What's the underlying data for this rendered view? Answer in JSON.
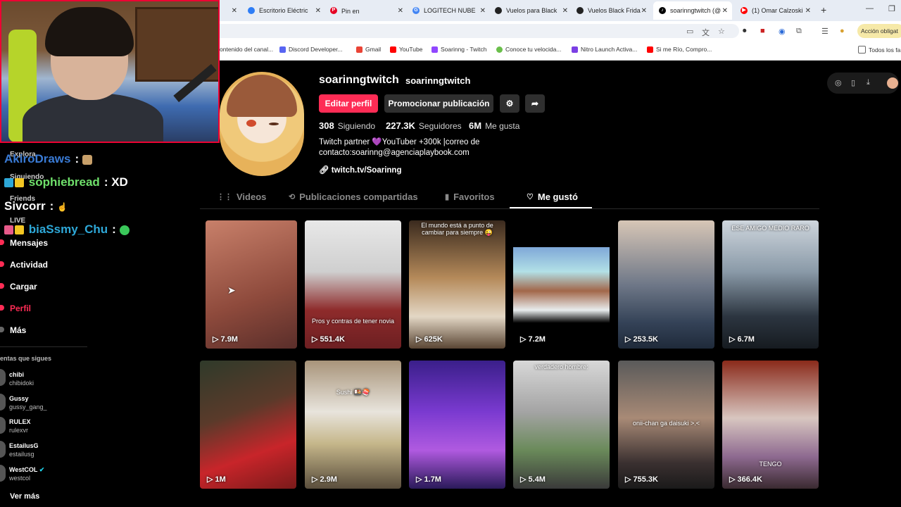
{
  "browser": {
    "tabs": [
      {
        "label": "Escritorio Eléctric",
        "color": "#2e7df6"
      },
      {
        "label": "Pin en ㅤ",
        "color": "#e60023"
      },
      {
        "label": "LOGITECH NUBE",
        "color": "#4285f4"
      },
      {
        "label": "Vuelos para Black",
        "color": "#222222"
      },
      {
        "label": "Vuelos Black Frida",
        "color": "#222222"
      },
      {
        "label": "soarinngtwitch (@",
        "color": "#000000"
      },
      {
        "label": "(1) Omar Calzoski",
        "color": "#ff0000"
      }
    ],
    "profile_chip": "Acción obligat",
    "bookmarks": [
      {
        "label": "ontenido del canal...",
        "color": "#9147ff"
      },
      {
        "label": "Discord Developer...",
        "color": "#5865f2"
      },
      {
        "label": "Gmail",
        "color": "#ea4335"
      },
      {
        "label": "YouTube",
        "color": "#ff0000"
      },
      {
        "label": "Soarinng - Twitch",
        "color": "#9147ff"
      },
      {
        "label": "Conoce tu velocida...",
        "color": "#6abf4b"
      },
      {
        "label": "Nitro Launch Activa...",
        "color": "#7b3fe4"
      },
      {
        "label": "Si me Río, Compro...",
        "color": "#ff0000"
      },
      {
        "label": "Todos los fa",
        "color": "#777777"
      }
    ]
  },
  "chat": [
    {
      "user": "AkiroDraws",
      "msg": ":",
      "color": "#3a7bd5"
    },
    {
      "user": "sophiebread",
      "msg": ": XD",
      "color": "#6fe06b"
    },
    {
      "user": "Sivcorr",
      "msg": ":",
      "color": "#ffffff"
    },
    {
      "user": "biaSsmy_Chu",
      "msg": ":",
      "color": "#2ea8d8"
    }
  ],
  "nav": {
    "items_faded": [
      "Explora",
      "Siguiendo",
      "Friends",
      "LIVE"
    ],
    "items": [
      "Mensajes",
      "Actividad",
      "Cargar",
      "Perfil",
      "Más"
    ],
    "active_color": "#fe2c55",
    "following_header": "entas que sigues",
    "following": [
      {
        "name": "chibi",
        "handle": "chibidoki"
      },
      {
        "name": "Gussy",
        "handle": "gussy_gang_"
      },
      {
        "name": "RULEX",
        "handle": "rulexvr"
      },
      {
        "name": "EstailusG",
        "handle": "estailusg"
      },
      {
        "name": "WestCOL",
        "handle": "westcol"
      }
    ],
    "see_more": "Ver más"
  },
  "profile": {
    "username": "soarinngtwitch",
    "nickname": "soarinngtwitch",
    "edit_label": "Editar perfil",
    "promote_label": "Promocionar publicación",
    "stats": [
      {
        "value": "308",
        "label": "Siguiendo"
      },
      {
        "value": "227.3K",
        "label": "Seguidores"
      },
      {
        "value": "6M",
        "label": "Me gusta"
      }
    ],
    "bio_line1": "Twitch partner 💜YouTuber +300k |correo de",
    "bio_line2": "contacto:soarinng@agenciaplaybook.com",
    "link": "twitch.tv/Soarinng",
    "accent": "#fe2c55"
  },
  "tabs": [
    "Videos",
    "Publicaciones compartidas",
    "Favoritos",
    "Me gustó"
  ],
  "videos": [
    {
      "views": "7.9M",
      "caption": "",
      "bg": "linear-gradient(160deg,#c8806a,#8e4a3c 60%,#5a2e2a)"
    },
    {
      "views": "551.4K",
      "caption": "Pros y contras de tener novia",
      "bg": "linear-gradient(180deg,#e8e8e8 0%,#cfcfcf 40%,#8e2b2b 70%,#6d1f22)"
    },
    {
      "views": "625K",
      "caption": "El mundo está a punto de cambiar para siempre 😜",
      "bg": "linear-gradient(180deg,#3a2a1e,#b58a5a 45%,#e3d7c5 75%,#5a4634)"
    },
    {
      "views": "7.2M",
      "caption": "",
      "bg": "linear-gradient(180deg,#000 0%,#000 21%,#7fa8d8 21%,#b2e0e6 40%,#a2674a 55%,#e8ecee 70%,#000 80%)"
    },
    {
      "views": "253.5K",
      "caption": "",
      "bg": "linear-gradient(180deg,#d7c6b6,#6f7888 50%,#344257 80%,#1f2a3a)"
    },
    {
      "views": "6.7M",
      "caption": "ESE AMIGO MEDIO RARO",
      "bg": "linear-gradient(180deg,#cfd6dd,#8a9aa8 40%,#2c3540 75%,#161b20)"
    },
    {
      "views": "1M",
      "caption": "",
      "bg": "linear-gradient(160deg,#2f3a2a,#5a3a2a 40%,#c8252a 70%,#7a1a1a)"
    },
    {
      "views": "2.9M",
      "caption": "Sushi 🍱🍣",
      "bg": "linear-gradient(180deg,#a8947a,#e8e4dc 40%,#c5b68a 65%,#5a4e3c)"
    },
    {
      "views": "1.7M",
      "caption": "",
      "bg": "linear-gradient(180deg,#3a1f8a,#7a3ad0 40%,#b05ae0 70%,#2a1a5a)"
    },
    {
      "views": "5.4M",
      "caption": "verdadero hombre:",
      "bg": "linear-gradient(180deg,#d8d8d8,#a4a4a4 40%,#6a8a5a 70%,#3a3a3a)"
    },
    {
      "views": "755.3K",
      "caption": "onii-chan ga daisuki >.<",
      "bg": "linear-gradient(180deg,#5a5a5a,#a88a76 45%,#3a3030 80%,#1a1a1a)"
    },
    {
      "views": "366.4K",
      "caption": "TENGO",
      "bg": "linear-gradient(180deg,#8a2a1a,#d8c6c0 45%,#8e6a90 75%,#3a2a30)"
    }
  ]
}
